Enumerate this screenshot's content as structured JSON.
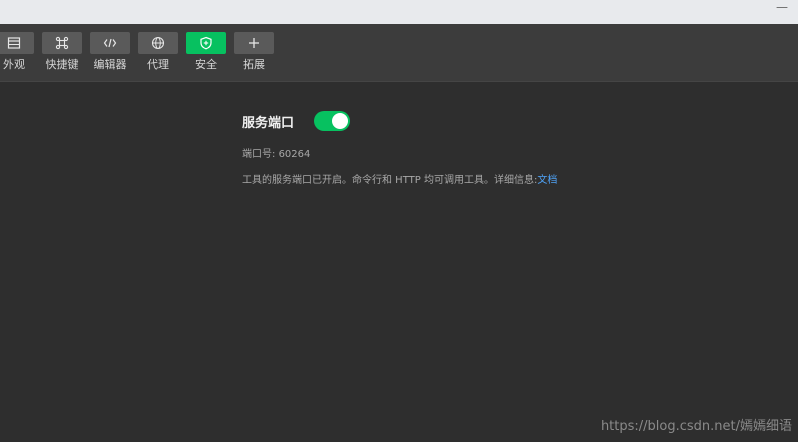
{
  "window": {
    "minimize_glyph": "—"
  },
  "toolbar": {
    "items": [
      {
        "label": "外观",
        "icon": "window-icon",
        "active": false
      },
      {
        "label": "快捷键",
        "icon": "command-key-icon",
        "active": false
      },
      {
        "label": "编辑器",
        "icon": "code-icon",
        "active": false
      },
      {
        "label": "代理",
        "icon": "globe-icon",
        "active": false
      },
      {
        "label": "安全",
        "icon": "shield-icon",
        "active": true
      },
      {
        "label": "拓展",
        "icon": "plus-icon",
        "active": false
      }
    ],
    "active_color": "#07c160"
  },
  "security": {
    "service_port_title": "服务端口",
    "service_port_enabled": true,
    "port_label": "端口号:",
    "port_value": "60264",
    "description": "工具的服务端口已开启。命令行和 HTTP 均可调用工具。详细信息:",
    "doc_link": "文档"
  },
  "watermark": "https://blog.csdn.net/嫣嫣细语"
}
